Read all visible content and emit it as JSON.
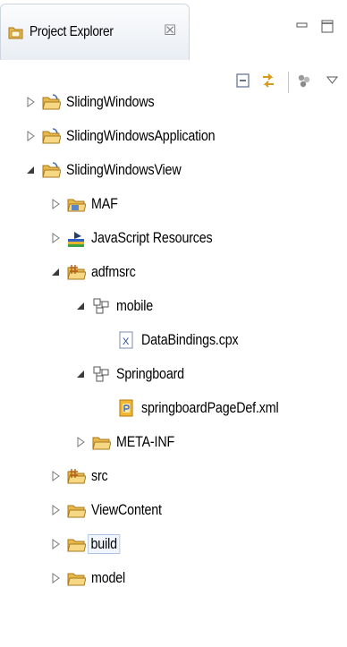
{
  "view": {
    "title": "Project Explorer",
    "close_glyph": "☒"
  },
  "icons": {
    "tab": "project-explorer-icon",
    "minimize": "minimize-icon",
    "maximize": "maximize-icon",
    "collapse_all": "collapse-all-icon",
    "link_with_editor": "link-with-editor-icon",
    "focus_on_active_task": "focus-on-active-task-icon",
    "view_menu": "view-menu-icon"
  },
  "tree": {
    "items": [
      {
        "label": "SlidingWindows",
        "icon": "project-folder-icon",
        "expanded": false
      },
      {
        "label": "SlidingWindowsApplication",
        "icon": "project-folder-icon",
        "expanded": false
      },
      {
        "label": "SlidingWindowsView",
        "icon": "project-folder-icon",
        "expanded": true
      },
      {
        "label": "MAF",
        "icon": "maf-folder-icon",
        "expanded": false
      },
      {
        "label": "JavaScript Resources",
        "icon": "javascript-resources-icon",
        "expanded": false
      },
      {
        "label": "adfmsrc",
        "icon": "source-folder-icon",
        "expanded": true
      },
      {
        "label": "mobile",
        "icon": "package-icon",
        "expanded": true
      },
      {
        "label": "DataBindings.cpx",
        "icon": "xml-file-icon",
        "expanded": null
      },
      {
        "label": "Springboard",
        "icon": "package-icon",
        "expanded": true
      },
      {
        "label": "springboardPageDef.xml",
        "icon": "page-def-file-icon",
        "expanded": null
      },
      {
        "label": "META-INF",
        "icon": "folder-icon",
        "expanded": false
      },
      {
        "label": "src",
        "icon": "source-folder-icon",
        "expanded": false
      },
      {
        "label": "ViewContent",
        "icon": "folder-icon",
        "expanded": false
      },
      {
        "label": "build",
        "icon": "folder-icon",
        "expanded": false,
        "selected": true
      },
      {
        "label": "model",
        "icon": "folder-icon",
        "expanded": false
      }
    ]
  },
  "colors": {
    "folder": "#e7b84a",
    "selection_border": "#a9c4e4",
    "twisty": "#6b6b6b"
  }
}
